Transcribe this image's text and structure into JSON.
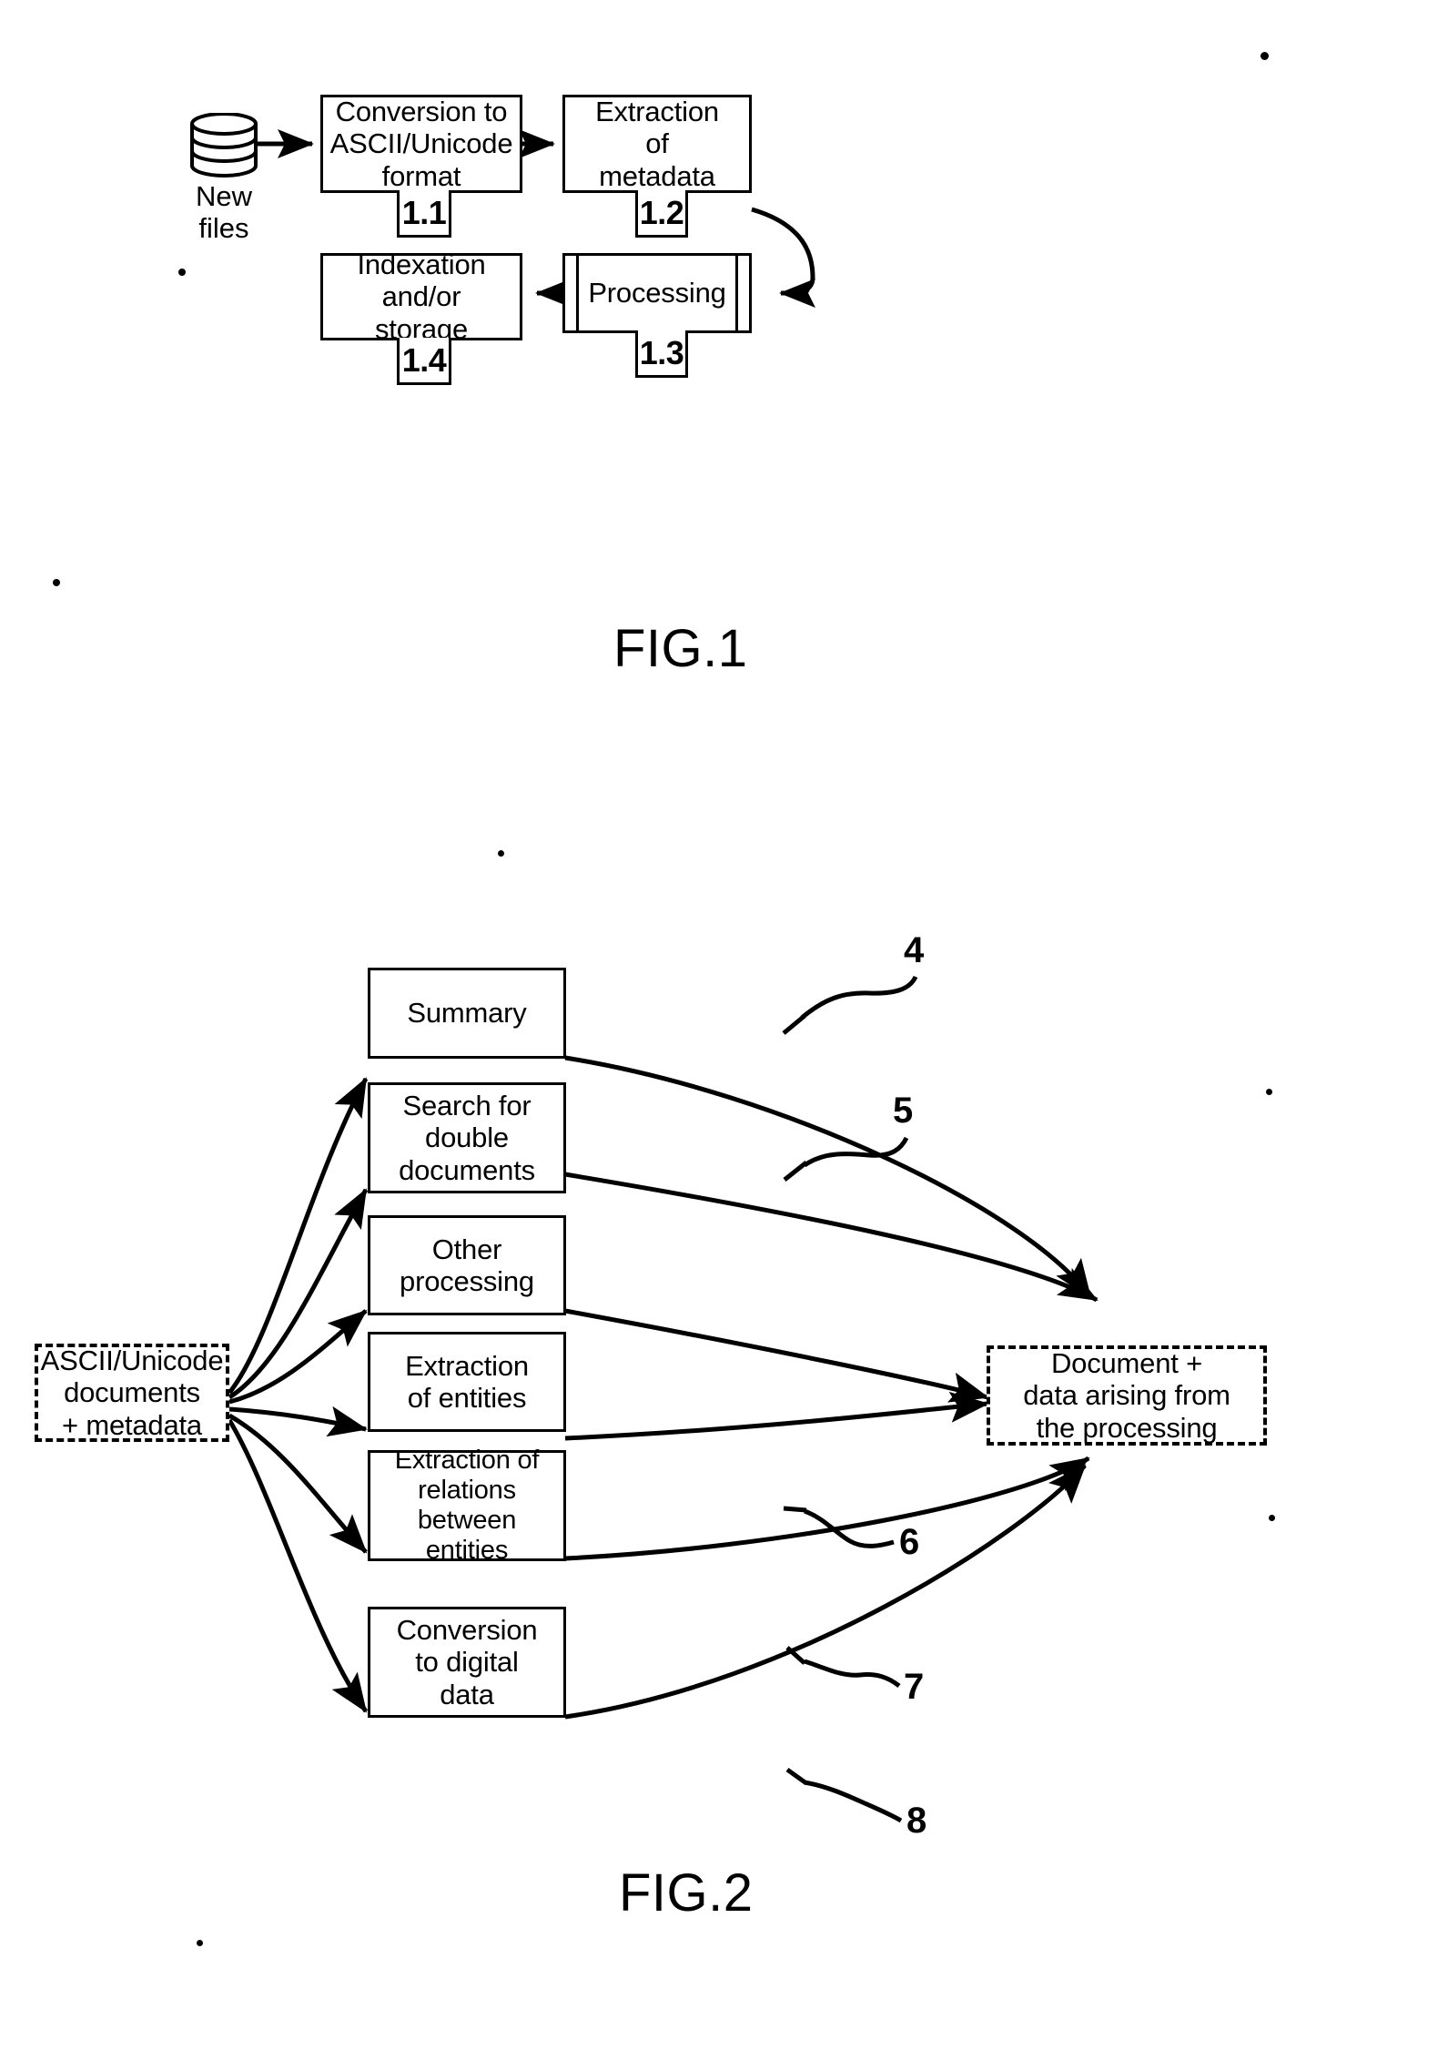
{
  "figures": [
    {
      "id": "fig1",
      "caption": "FIG.1",
      "source": {
        "label": "New\nfiles",
        "icon": "database-cylinder-icon"
      },
      "steps": [
        {
          "ref": "1.1",
          "label": "Conversion to\nASCII/Unicode\nformat",
          "shape": "process"
        },
        {
          "ref": "1.2",
          "label": "Extraction\nof\nmetadata",
          "shape": "process"
        },
        {
          "ref": "1.3",
          "label": "Processing",
          "shape": "predefined-process"
        },
        {
          "ref": "1.4",
          "label": "Indexation\nand/or\nstorage",
          "shape": "process"
        }
      ]
    },
    {
      "id": "fig2",
      "caption": "FIG.2",
      "input": {
        "label": "ASCII/Unicode\ndocuments\n+ metadata",
        "shape": "dashed"
      },
      "output": {
        "label": "Document +\ndata arising from\nthe processing",
        "shape": "dashed"
      },
      "branches": [
        {
          "ref": "4",
          "label": "Summary"
        },
        {
          "ref": "5",
          "label": "Search for\ndouble\ndocuments"
        },
        {
          "ref": "",
          "label": "Other\nprocessing"
        },
        {
          "ref": "6",
          "label": "Extraction\nof entities"
        },
        {
          "ref": "7",
          "label": "Extraction of\nrelations\nbetween entities"
        },
        {
          "ref": "8",
          "label": "Conversion\nto digital\ndata"
        }
      ]
    }
  ],
  "colors": {
    "ink": "#000000",
    "paper": "#ffffff"
  }
}
